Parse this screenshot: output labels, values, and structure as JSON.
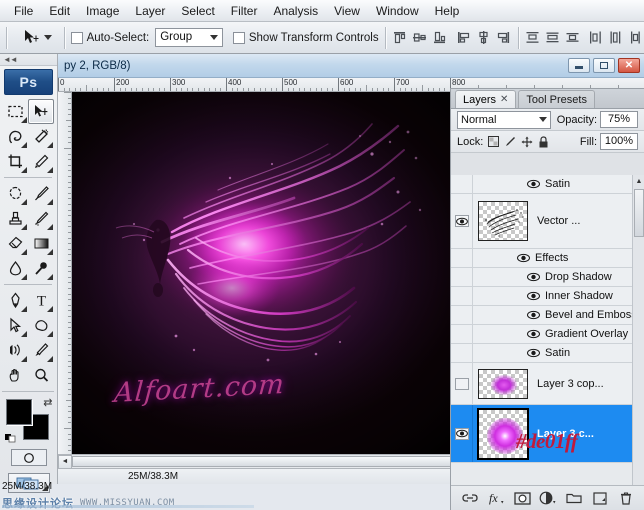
{
  "app": {
    "name": "Adobe Photoshop",
    "logo_text": "Ps"
  },
  "menubar": {
    "items": [
      {
        "label": "File"
      },
      {
        "label": "Edit"
      },
      {
        "label": "Image"
      },
      {
        "label": "Layer"
      },
      {
        "label": "Select"
      },
      {
        "label": "Filter"
      },
      {
        "label": "Analysis"
      },
      {
        "label": "View"
      },
      {
        "label": "Window"
      },
      {
        "label": "Help"
      }
    ]
  },
  "options_bar": {
    "tool": "move-tool",
    "auto_select_label": "Auto-Select:",
    "auto_select_value": "Group",
    "show_transform_label": "Show Transform Controls",
    "align_icons": [
      "align-top-edges",
      "align-vertical-centers",
      "align-bottom-edges",
      "align-left-edges",
      "align-horizontal-centers",
      "align-right-edges",
      "distribute-top-edges",
      "distribute-vertical-centers",
      "distribute-bottom-edges",
      "distribute-left-edges",
      "distribute-horizontal-centers",
      "distribute-right-edges"
    ]
  },
  "toolbox": {
    "tools": [
      {
        "name": "rectangular-marquee-tool"
      },
      {
        "name": "move-tool",
        "selected": true
      },
      {
        "name": "lasso-tool"
      },
      {
        "name": "magic-wand-tool"
      },
      {
        "name": "crop-tool"
      },
      {
        "name": "slice-tool"
      },
      {
        "name": "healing-brush-tool"
      },
      {
        "name": "brush-tool"
      },
      {
        "name": "clone-stamp-tool"
      },
      {
        "name": "history-brush-tool"
      },
      {
        "name": "eraser-tool"
      },
      {
        "name": "gradient-tool"
      },
      {
        "name": "blur-tool"
      },
      {
        "name": "dodge-tool"
      },
      {
        "name": "pen-tool"
      },
      {
        "name": "type-tool"
      },
      {
        "name": "path-selection-tool"
      },
      {
        "name": "shape-tool"
      },
      {
        "name": "notes-tool"
      },
      {
        "name": "eyedropper-tool"
      },
      {
        "name": "hand-tool"
      },
      {
        "name": "zoom-tool"
      }
    ],
    "foreground_color": "#000000",
    "background_color": "#000000",
    "quick_mask_name": "quick-mask-mode",
    "screen_mode_name": "screen-mode"
  },
  "document": {
    "title": "py 2, RGB/8)",
    "window_buttons": [
      "minimize",
      "maximize",
      "close"
    ],
    "ruler_h_labels": [
      "0",
      "200",
      "300",
      "400",
      "500",
      "600",
      "700",
      "800"
    ],
    "artwork": {
      "signature": "Alfoart.com",
      "description": "purple magenta liquid splash",
      "background_color": "#230a24",
      "accent_color": "#de01ff"
    }
  },
  "status_bar": {
    "zoom": "",
    "doc_sizes": "25M/38.3M"
  },
  "panel": {
    "tabs": [
      {
        "label": "Layers",
        "active": true,
        "closable": true
      },
      {
        "label": "Tool Presets",
        "active": false,
        "closable": false
      }
    ],
    "blend_mode": "Normal",
    "opacity_label": "Opacity:",
    "opacity_value": "75%",
    "lock_label": "Lock:",
    "lock_icons": [
      "lock-transparent-pixels",
      "lock-image-pixels",
      "lock-position",
      "lock-all"
    ],
    "fill_label": "Fill:",
    "fill_value": "100%",
    "rows": [
      {
        "type": "effect",
        "label": "Satin",
        "indent": 2,
        "visible": true
      },
      {
        "type": "layer",
        "label": "Vector ...",
        "visible": true,
        "has_fx": true,
        "selected": false
      },
      {
        "type": "effect",
        "label": "Effects",
        "indent": 1,
        "visible": true
      },
      {
        "type": "effect",
        "label": "Drop Shadow",
        "indent": 2,
        "visible": true
      },
      {
        "type": "effect",
        "label": "Inner Shadow",
        "indent": 2,
        "visible": true
      },
      {
        "type": "effect",
        "label": "Bevel and Emboss",
        "indent": 2,
        "visible": true
      },
      {
        "type": "effect",
        "label": "Gradient Overlay",
        "indent": 2,
        "visible": true
      },
      {
        "type": "effect",
        "label": "Satin",
        "indent": 2,
        "visible": true
      },
      {
        "type": "layer",
        "label": "Layer 3 cop...",
        "visible": false,
        "has_fx": false,
        "selected": false
      },
      {
        "type": "layer",
        "label": "Layer 3 c...",
        "visible": true,
        "has_fx": false,
        "selected": true
      }
    ],
    "bottom_icons": [
      "link-layers-icon",
      "add-layer-style-icon",
      "add-layer-mask-icon",
      "new-adjustment-layer-icon",
      "new-group-icon",
      "new-layer-icon",
      "delete-layer-icon"
    ]
  },
  "annotation": {
    "hex_value": "#de01ff",
    "color": "#c11a3c"
  },
  "watermark": {
    "chinese": "思缘设计论坛",
    "url": "WWW.MISSYUAN.COM"
  }
}
